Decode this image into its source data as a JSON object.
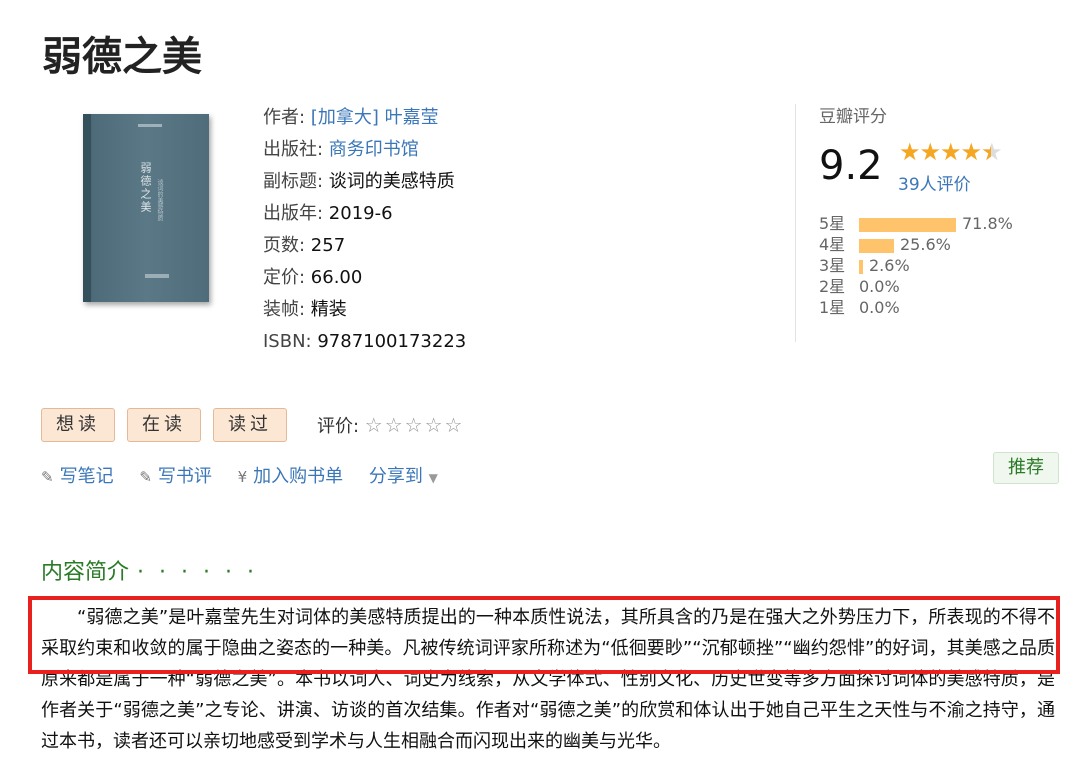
{
  "book": {
    "title": "弱德之美",
    "cover": {
      "title": "弱德之美",
      "subtitle": "谈词的美感特质"
    },
    "info": [
      {
        "label": "作者: ",
        "value": "[加拿大] 叶嘉莹",
        "is_link": true
      },
      {
        "label": "出版社: ",
        "value": "商务印书馆",
        "is_link": true
      },
      {
        "label": "副标题: ",
        "value": "谈词的美感特质",
        "is_link": false
      },
      {
        "label": "出版年: ",
        "value": "2019-6",
        "is_link": false
      },
      {
        "label": "页数: ",
        "value": "257",
        "is_link": false
      },
      {
        "label": "定价: ",
        "value": "66.00",
        "is_link": false
      },
      {
        "label": "装帧: ",
        "value": "精装",
        "is_link": false
      },
      {
        "label": "ISBN: ",
        "value": "9787100173223",
        "is_link": false
      }
    ]
  },
  "rating": {
    "label": "豆瓣评分",
    "score": "9.2",
    "stars_value": 4.5,
    "votes": "39人评价",
    "distribution": [
      {
        "label": "5星",
        "pct_text": "71.8%",
        "pct": 71.8
      },
      {
        "label": "4星",
        "pct_text": "25.6%",
        "pct": 25.6
      },
      {
        "label": "3星",
        "pct_text": "2.6%",
        "pct": 2.6
      },
      {
        "label": "2星",
        "pct_text": "0.0%",
        "pct": 0
      },
      {
        "label": "1星",
        "pct_text": "0.0%",
        "pct": 0
      }
    ]
  },
  "buttons": {
    "want": "想读",
    "reading": "在读",
    "read": "读过"
  },
  "user_rating": {
    "label": "评价: ",
    "stars": "☆☆☆☆☆"
  },
  "actions": {
    "note": "写笔记",
    "review": "写书评",
    "cart_symbol": "¥",
    "cart": "加入购书单",
    "share": "分享到"
  },
  "recommend": "推荐",
  "intro": {
    "heading": "内容简介",
    "dots": "· · · · · ·",
    "text": "“弱德之美”是叶嘉莹先生对词体的美感特质提出的一种本质性说法，其所具含的乃是在强大之外势压力下，所表现的不得不采取约束和收敛的属于隐曲之姿态的一种美。凡被传统词评家所称述为“低徊要眇”“沉郁顿挫”“幽约怨悱”的好词，其美感之品质原来都是属于一种“弱德之美”。本书以词人、词史为线索，从文学体式、性别文化、历史世变等多方面探讨词体的美感特质，是作者关于“弱德之美”之专论、讲演、访谈的首次结集。作者对“弱德之美”的欣赏和体认出于她自己平生之天性与不渝之持守，通过本书，读者还可以亲切地感受到学术与人生相融合而闪现出来的幽美与光华。"
  },
  "colors": {
    "link": "#3b77b8",
    "green": "#2a7a26",
    "bar": "#ffc36b",
    "highlight": "#e8201e",
    "star": "#f5a623"
  }
}
